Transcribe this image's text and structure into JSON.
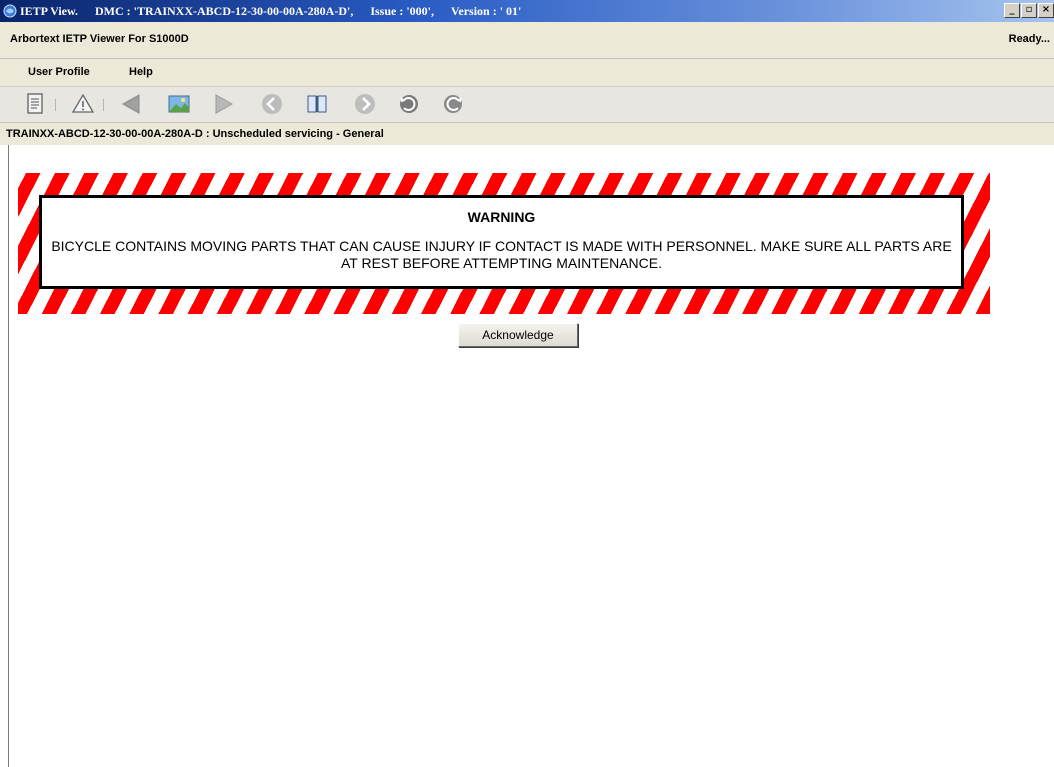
{
  "window": {
    "app_label": "IETP View.",
    "dmc": "DMC : 'TRAINXX-ABCD-12-30-00-00A-280A-D',",
    "issue": "Issue : '000',",
    "version": "Version : ' 01'"
  },
  "header": {
    "app_name": "Arbortext IETP Viewer For S1000D",
    "status": "Ready..."
  },
  "menu": {
    "items": [
      {
        "label": "User Profile"
      },
      {
        "label": "Help"
      }
    ]
  },
  "toolbar": {
    "buttons": [
      {
        "icon": "document-icon"
      },
      {
        "icon": "warning-icon"
      },
      {
        "icon": "previous-icon"
      },
      {
        "icon": "illustration-icon"
      },
      {
        "icon": "next-icon"
      },
      {
        "icon": "back-icon"
      },
      {
        "icon": "book-icon"
      },
      {
        "icon": "forward-icon"
      },
      {
        "icon": "undo-icon"
      },
      {
        "icon": "redo-icon"
      }
    ]
  },
  "data_module": {
    "title": "TRAINXX-ABCD-12-30-00-00A-280A-D : Unscheduled servicing - General"
  },
  "warning": {
    "heading": "WARNING",
    "text": "BICYCLE CONTAINS MOVING PARTS THAT CAN CAUSE INJURY IF CONTACT IS MADE WITH PERSONNEL. MAKE SURE ALL PARTS ARE AT REST BEFORE ATTEMPTING MAINTENANCE.",
    "stripe_color": "#ff0000"
  },
  "actions": {
    "acknowledge_label": "Acknowledge"
  }
}
